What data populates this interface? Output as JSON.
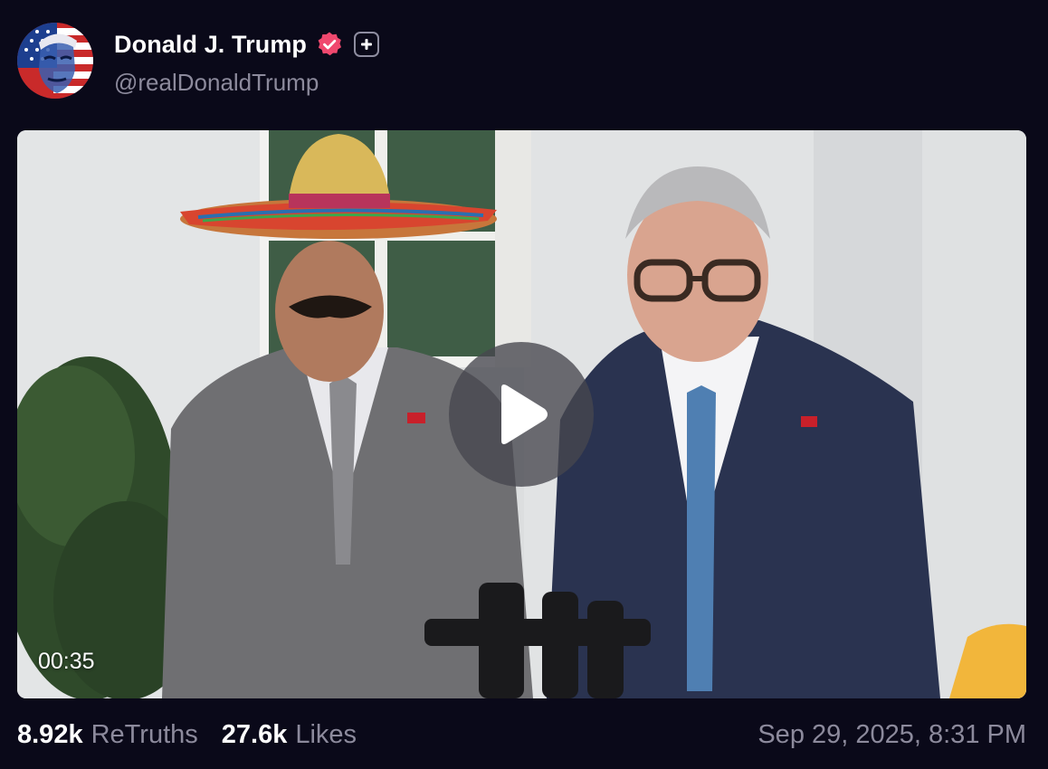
{
  "author": {
    "display_name": "Donald J. Trump",
    "handle": "@realDonaldTrump",
    "avatar_icon": "flag-portrait-avatar",
    "verified_icon": "verified-badge-icon",
    "plus_icon": "plus-badge-icon"
  },
  "media": {
    "type": "video",
    "duration": "00:35",
    "play_icon": "play-icon"
  },
  "stats": {
    "retruths_count": "8.92k",
    "retruths_label": "ReTruths",
    "likes_count": "27.6k",
    "likes_label": "Likes"
  },
  "timestamp": "Sep 29, 2025, 8:31 PM",
  "colors": {
    "background": "#0a0919",
    "verified": "#f0486e",
    "muted_text": "#8c8a9c"
  }
}
